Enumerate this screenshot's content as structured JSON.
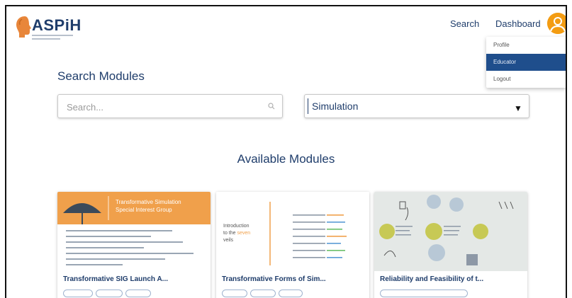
{
  "header": {
    "logo_text": "ASPiH",
    "nav": {
      "search": "Search",
      "dashboard": "Dashboard"
    },
    "avatar_icon": "user-avatar-icon"
  },
  "user_menu": {
    "items": [
      {
        "label": "Profile"
      },
      {
        "label": "Educator"
      },
      {
        "label": "Logout"
      }
    ],
    "selected_index": 1
  },
  "search": {
    "title": "Search Modules",
    "placeholder": "Search...",
    "filter_value": "Simulation"
  },
  "modules": {
    "title": "Available Modules",
    "cards": [
      {
        "title": "Transformative SIG Launch A...",
        "thumb_heading": "Transformative Simulation Special Interest Group"
      },
      {
        "title": "Transformative Forms of Sim...",
        "thumb_heading": "Introduction to the seven veils"
      },
      {
        "title": "Reliability and Feasibility of t..."
      }
    ]
  },
  "colors": {
    "brand": "#1f3d6b",
    "accent": "#f39c12",
    "menu_selected": "#1f4e8c",
    "thumb_orange": "#f0a04b"
  }
}
